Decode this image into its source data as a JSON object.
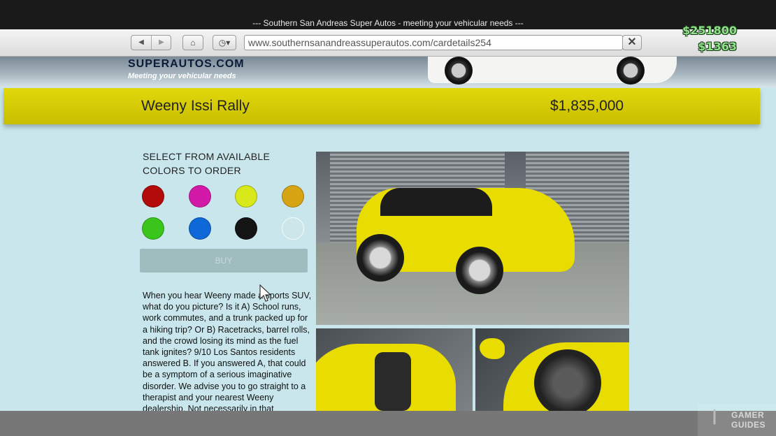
{
  "window": {
    "title": "--- Southern San Andreas Super Autos - meeting your vehicular needs ---"
  },
  "toolbar": {
    "back_icon": "back-icon",
    "forward_icon": "forward-icon",
    "home_icon": "home-icon",
    "history_icon": "history-dropdown-icon",
    "url": "www.southernsanandreassuperautos.com/cardetails254",
    "close_icon": "close-icon"
  },
  "hud": {
    "bank": "$251800",
    "cash": "$1363"
  },
  "banner": {
    "logo": "SUPERAUTOS.COM",
    "tagline": "Meeting your vehicular needs"
  },
  "vehicle": {
    "name": "Weeny Issi Rally",
    "price": "$1,835,000"
  },
  "colors": {
    "title": "SELECT FROM AVAILABLE COLORS TO ORDER",
    "swatches": [
      "#b30a0a",
      "#d319a8",
      "#d8e81a",
      "#d7a414",
      "#3ac51c",
      "#0e68d8",
      "#141414",
      "#cde6ea"
    ]
  },
  "buy_label": "BUY",
  "description": "When you hear Weeny made a sports SUV, what do you picture? Is it A) School runs, work commutes, and a trunk packed up for a hiking trip? Or B) Racetracks, barrel rolls, and the crowd losing its mind as the fuel tank ignites? 9/10 Los Santos residents answered B. If you answered A, that could be a symptom of a serious imaginative disorder. We advise you to go straight to a therapist and your nearest Weeny dealership. Not necessarily in that",
  "watermark": {
    "line1": "GAMER",
    "line2": "GUIDES"
  }
}
